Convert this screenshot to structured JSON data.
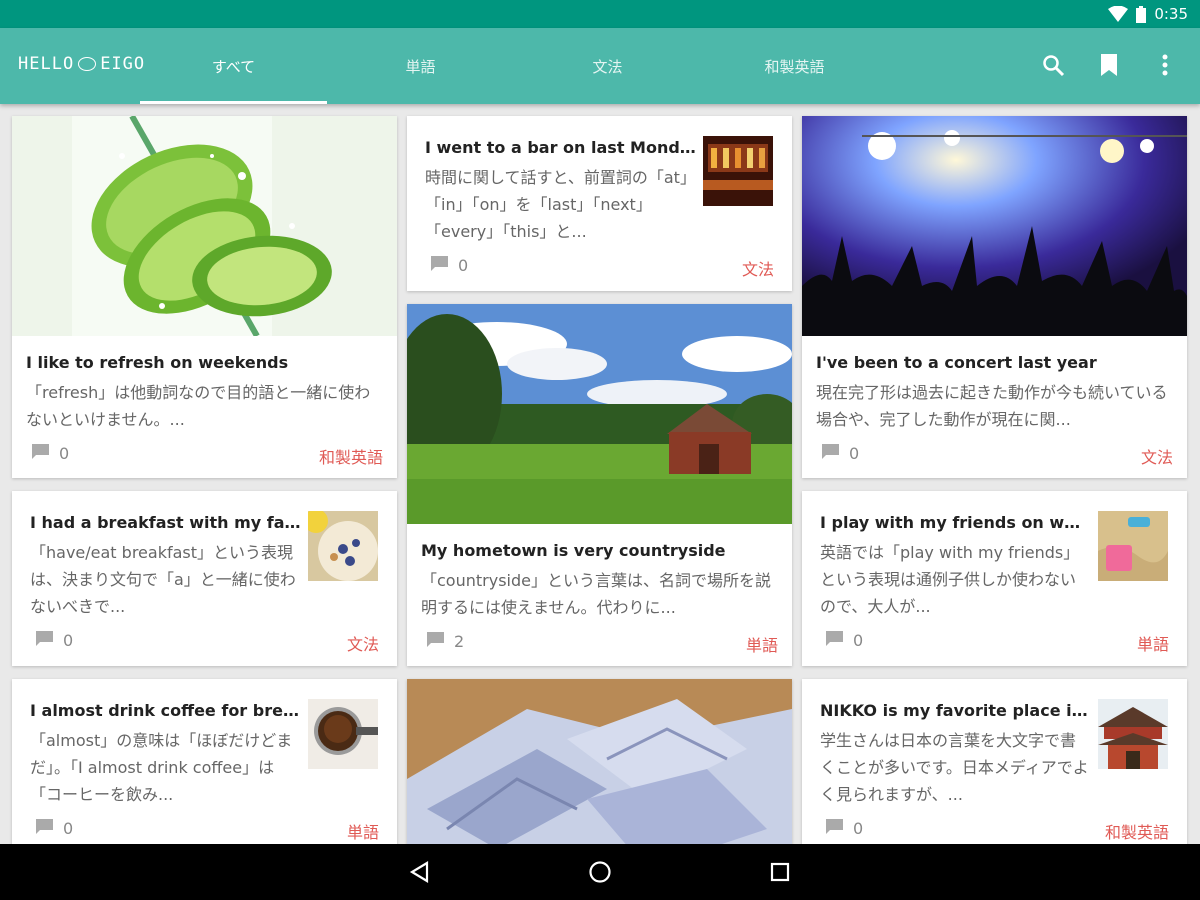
{
  "status": {
    "time": "0:35",
    "wifi_icon": "wifi-icon",
    "battery_icon": "battery-icon"
  },
  "app": {
    "logo_left": "HELLO",
    "logo_right": "EIGO"
  },
  "tabs": [
    {
      "label": "すべて",
      "active": true
    },
    {
      "label": "単語",
      "active": false
    },
    {
      "label": "文法",
      "active": false
    },
    {
      "label": "和製英語",
      "active": false
    }
  ],
  "actions": {
    "search_icon": "search-icon",
    "bookmark_icon": "bookmark-icon",
    "more_icon": "more-vert-icon"
  },
  "cards": {
    "lime": {
      "title": "I like to refresh on weekends",
      "body": "「refresh」は他動詞なので目的語と一緒に使わないといけません。...",
      "comments": "0",
      "category": "和製英語"
    },
    "bar": {
      "title": "I went to a bar on last Monday",
      "body": "時間に関して話すと、前置詞の「at」「in」「on」を「last」「next」「every」「this」と...",
      "comments": "0",
      "category": "文法"
    },
    "concert": {
      "title": "I've been to a concert last year",
      "body": "現在完了形は過去に起きた動作が今も続いている場合や、完了した動作が現在に関...",
      "comments": "0",
      "category": "文法"
    },
    "breakfast": {
      "title": "I had a breakfast with my family",
      "body": "「have/eat breakfast」という表現は、決まり文句で「a」と一緒に使わないべきで...",
      "comments": "0",
      "category": "文法"
    },
    "hometown": {
      "title": "My hometown is very countryside",
      "body": "「countryside」という言葉は、名詞で場所を説明するには使えません。代わりに...",
      "comments": "2",
      "category": "単語"
    },
    "friends": {
      "title": "I play with my friends on weekends",
      "body": "英語では「play with my friends」という表現は通例子供しか使わないので、大人が...",
      "comments": "0",
      "category": "単語"
    },
    "coffee": {
      "title": "I almost drink coffee for breakfast",
      "body": "「almost」の意味は「ほぼだけどまだ」。「I almost drink coffee」は「コーヒーを飲み...",
      "comments": "0",
      "category": "単語"
    },
    "nikko": {
      "title": "NIKKO is my favorite place in Japan",
      "body": "学生さんは日本の言葉を大文字で書くことが多いです。日本メディアでよく見られますが、...",
      "comments": "0",
      "category": "和製英語"
    }
  },
  "colors": {
    "status": "#00967f",
    "appbar": "#4db8aa",
    "category": "#e05a55"
  }
}
